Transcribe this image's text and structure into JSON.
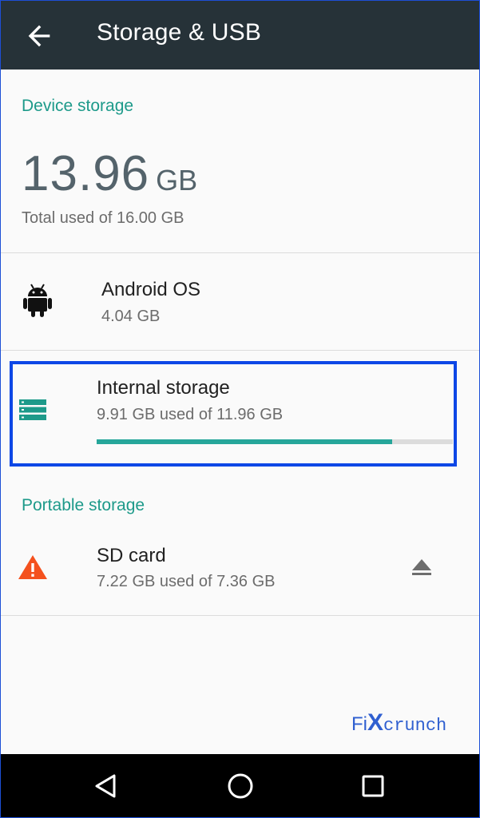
{
  "header": {
    "title": "Storage & USB"
  },
  "device_storage": {
    "label": "Device storage",
    "used_amount": "13.96",
    "used_unit": "GB",
    "total_text": "Total used of 16.00 GB"
  },
  "items": [
    {
      "title": "Android OS",
      "subtitle": "4.04 GB",
      "icon": "android-icon"
    },
    {
      "title": "Internal storage",
      "subtitle": "9.91 GB used of 11.96 GB",
      "icon": "storage-icon",
      "used_fraction": 0.829
    }
  ],
  "portable_storage": {
    "label": "Portable storage",
    "sd_card": {
      "title": "SD card",
      "subtitle": "7.22 GB used of 7.36 GB",
      "icon": "warning-icon",
      "action_icon": "eject-icon"
    }
  },
  "watermark": {
    "part1": "Fi",
    "part2": "X",
    "part3": "crunch"
  },
  "colors": {
    "accent": "#1d9a8a",
    "progress": "#26a69a",
    "appbar": "#263238",
    "highlight": "#0d47e6",
    "warning": "#f4511e"
  },
  "navbar": {
    "buttons": [
      "back-nav-icon",
      "home-nav-icon",
      "recents-nav-icon"
    ]
  }
}
